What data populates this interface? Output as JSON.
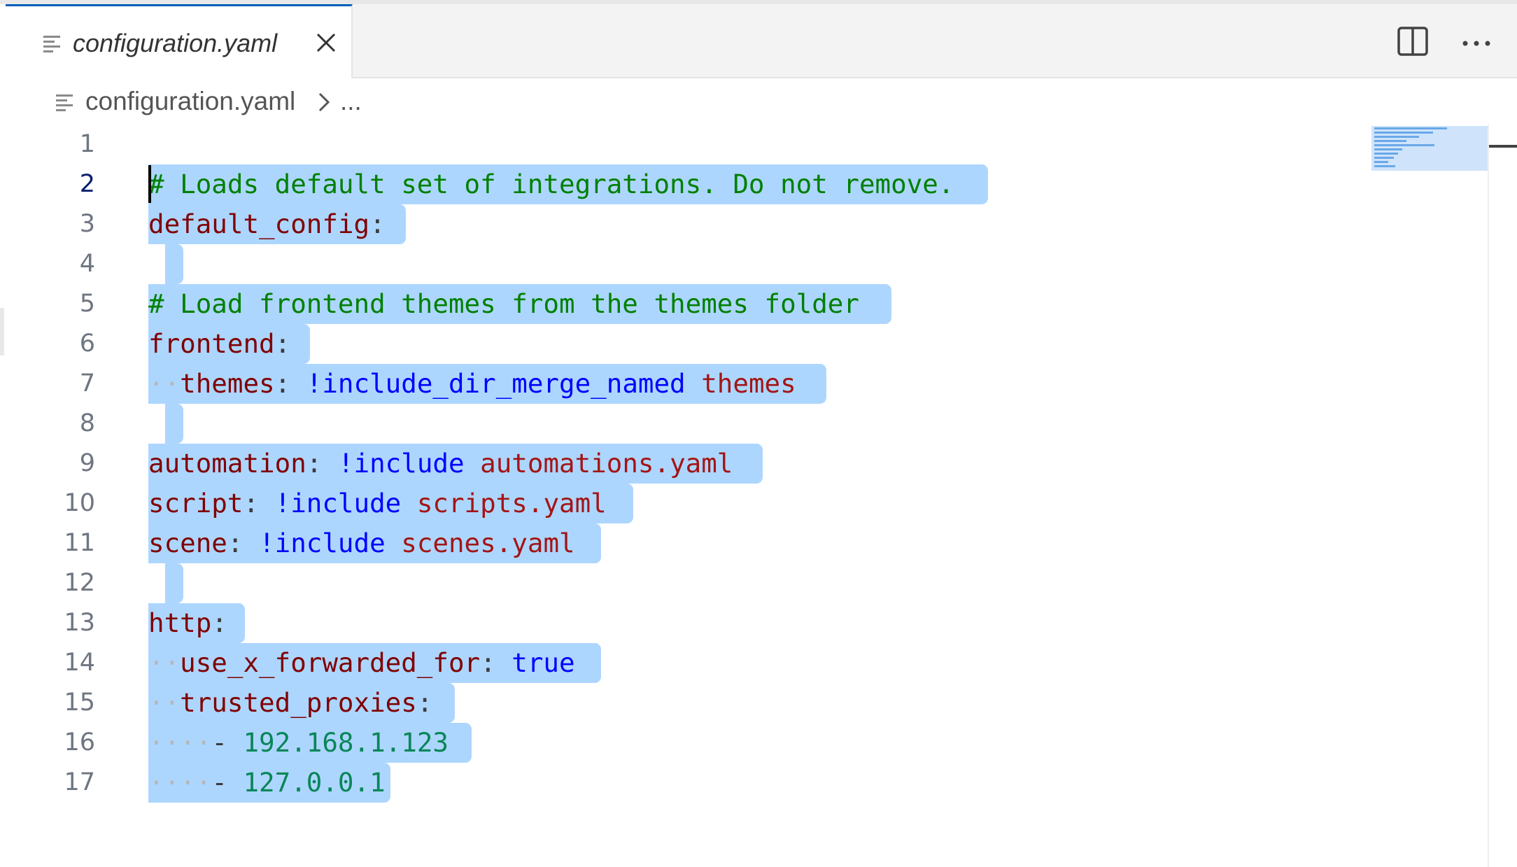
{
  "tab": {
    "label": "configuration.yaml",
    "close_symbol": "×"
  },
  "actions": {
    "split_editor": "split-editor-icon",
    "more_actions": "more-icon"
  },
  "breadcrumb": {
    "file": "configuration.yaml",
    "ellipsis": "..."
  },
  "editor": {
    "active_line": 2,
    "lines": [
      {
        "n": "1",
        "sel_end": 0,
        "tokens": []
      },
      {
        "n": "2",
        "sel_end": 1412,
        "tokens": [
          {
            "t": "# Loads default set of integrations. Do not remove.",
            "c": "c-cm"
          }
        ]
      },
      {
        "n": "3",
        "sel_end": 580,
        "tokens": [
          {
            "t": "default_config",
            "c": "c-key"
          },
          {
            "t": ":",
            "c": "c-pun"
          }
        ]
      },
      {
        "n": "4",
        "sel_end": 0,
        "tokens": []
      },
      {
        "n": "5",
        "sel_end": 1274,
        "tokens": [
          {
            "t": "# Load frontend themes from the themes folder",
            "c": "c-cm"
          }
        ]
      },
      {
        "n": "6",
        "sel_end": 443,
        "tokens": [
          {
            "t": "frontend",
            "c": "c-key"
          },
          {
            "t": ":",
            "c": "c-pun"
          }
        ]
      },
      {
        "n": "7",
        "sel_end": 1181,
        "tokens": [
          {
            "t": "··",
            "c": "c-ws"
          },
          {
            "t": "themes",
            "c": "c-key"
          },
          {
            "t": ": ",
            "c": "c-pun"
          },
          {
            "t": "!include_dir_merge_named",
            "c": "c-tag"
          },
          {
            "t": " ",
            "c": "c-pun"
          },
          {
            "t": "themes",
            "c": "c-str"
          }
        ]
      },
      {
        "n": "8",
        "sel_end": 0,
        "tokens": []
      },
      {
        "n": "9",
        "sel_end": 1090,
        "tokens": [
          {
            "t": "automation",
            "c": "c-key"
          },
          {
            "t": ": ",
            "c": "c-pun"
          },
          {
            "t": "!include",
            "c": "c-tag"
          },
          {
            "t": " ",
            "c": "c-pun"
          },
          {
            "t": "automations.yaml",
            "c": "c-str"
          }
        ]
      },
      {
        "n": "10",
        "sel_end": 905,
        "tokens": [
          {
            "t": "script",
            "c": "c-key"
          },
          {
            "t": ": ",
            "c": "c-pun"
          },
          {
            "t": "!include",
            "c": "c-tag"
          },
          {
            "t": " ",
            "c": "c-pun"
          },
          {
            "t": "scripts.yaml",
            "c": "c-str"
          }
        ]
      },
      {
        "n": "11",
        "sel_end": 859,
        "tokens": [
          {
            "t": "scene",
            "c": "c-key"
          },
          {
            "t": ": ",
            "c": "c-pun"
          },
          {
            "t": "!include",
            "c": "c-tag"
          },
          {
            "t": " ",
            "c": "c-pun"
          },
          {
            "t": "scenes.yaml",
            "c": "c-str"
          }
        ]
      },
      {
        "n": "12",
        "sel_end": 0,
        "tokens": []
      },
      {
        "n": "13",
        "sel_end": 350,
        "tokens": [
          {
            "t": "http",
            "c": "c-key"
          },
          {
            "t": ":",
            "c": "c-pun"
          }
        ]
      },
      {
        "n": "14",
        "sel_end": 859,
        "tokens": [
          {
            "t": "··",
            "c": "c-ws"
          },
          {
            "t": "use_x_forwarded_for",
            "c": "c-key"
          },
          {
            "t": ": ",
            "c": "c-pun"
          },
          {
            "t": "true",
            "c": "c-bool"
          }
        ]
      },
      {
        "n": "15",
        "sel_end": 650,
        "tokens": [
          {
            "t": "··",
            "c": "c-ws"
          },
          {
            "t": "trusted_proxies",
            "c": "c-key"
          },
          {
            "t": ":",
            "c": "c-pun"
          }
        ]
      },
      {
        "n": "16",
        "sel_end": 674,
        "tokens": [
          {
            "t": "····",
            "c": "c-ws"
          },
          {
            "t": "- ",
            "c": "c-pun"
          },
          {
            "t": "192.168.1.123",
            "c": "c-num"
          }
        ]
      },
      {
        "n": "17",
        "sel_end": 558,
        "tokens": [
          {
            "t": "····",
            "c": "c-ws"
          },
          {
            "t": "- ",
            "c": "c-pun"
          },
          {
            "t": "127.0.0.1",
            "c": "c-num"
          }
        ]
      }
    ]
  },
  "colors": {
    "selection": "#add6ff",
    "accent": "#005fb8"
  }
}
